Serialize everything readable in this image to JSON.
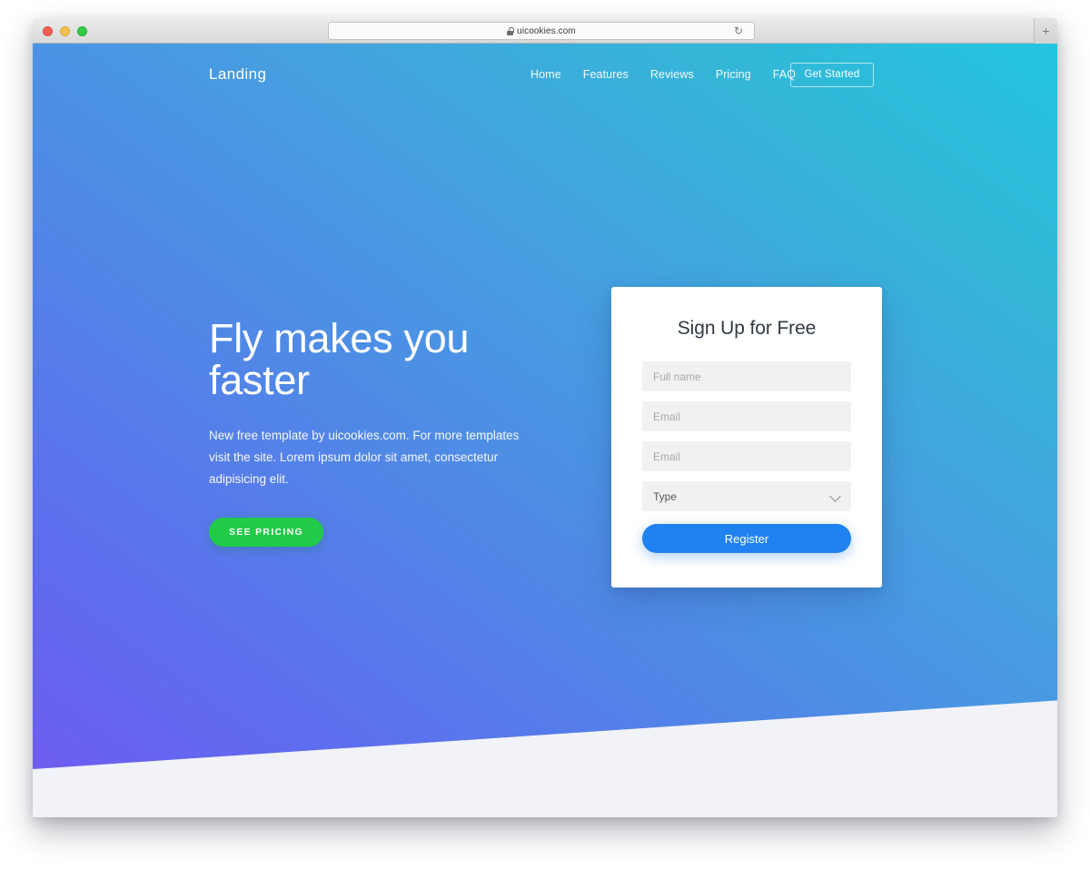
{
  "browser": {
    "url": "uicookies.com",
    "lock_icon": "lock-icon",
    "reload_icon": "reload-icon",
    "reload_glyph": "↻",
    "newtab_label": "+",
    "traffic_lights": [
      {
        "name": "close",
        "color": "#ef5f56"
      },
      {
        "name": "minimize",
        "color": "#f5bf4f"
      },
      {
        "name": "maximize",
        "color": "#2fcc45"
      }
    ]
  },
  "nav": {
    "brand": "Landing",
    "links": [
      {
        "label": "Home"
      },
      {
        "label": "Features"
      },
      {
        "label": "Reviews"
      },
      {
        "label": "Pricing"
      },
      {
        "label": "FAQ"
      }
    ],
    "cta_label": "Get Started"
  },
  "hero": {
    "title": "Fly makes you faster",
    "desc_part1": "New free template by ",
    "desc_link1": "uicookies.com",
    "desc_part2": ". For more templates visit the ",
    "desc_link2": "site",
    "desc_part3": ". Lorem ipsum dolor sit amet, consectetur adipisicing elit.",
    "button_label": "SEE PRICING",
    "button_color": "#20cb48",
    "gradient_from": "#6f5cf0",
    "gradient_to": "#24c5e0"
  },
  "signup": {
    "title": "Sign Up for Free",
    "fields": [
      {
        "name": "full-name",
        "placeholder": "Full name",
        "value": ""
      },
      {
        "name": "email",
        "placeholder": "Email",
        "value": ""
      },
      {
        "name": "email-confirm",
        "placeholder": "Email",
        "value": ""
      }
    ],
    "select": {
      "label": "Type",
      "chevron_icon": "chevron-down-icon"
    },
    "submit_label": "Register",
    "submit_color": "#1f82f0"
  },
  "page": {
    "bottom_band_color": "#f1f3f9"
  }
}
